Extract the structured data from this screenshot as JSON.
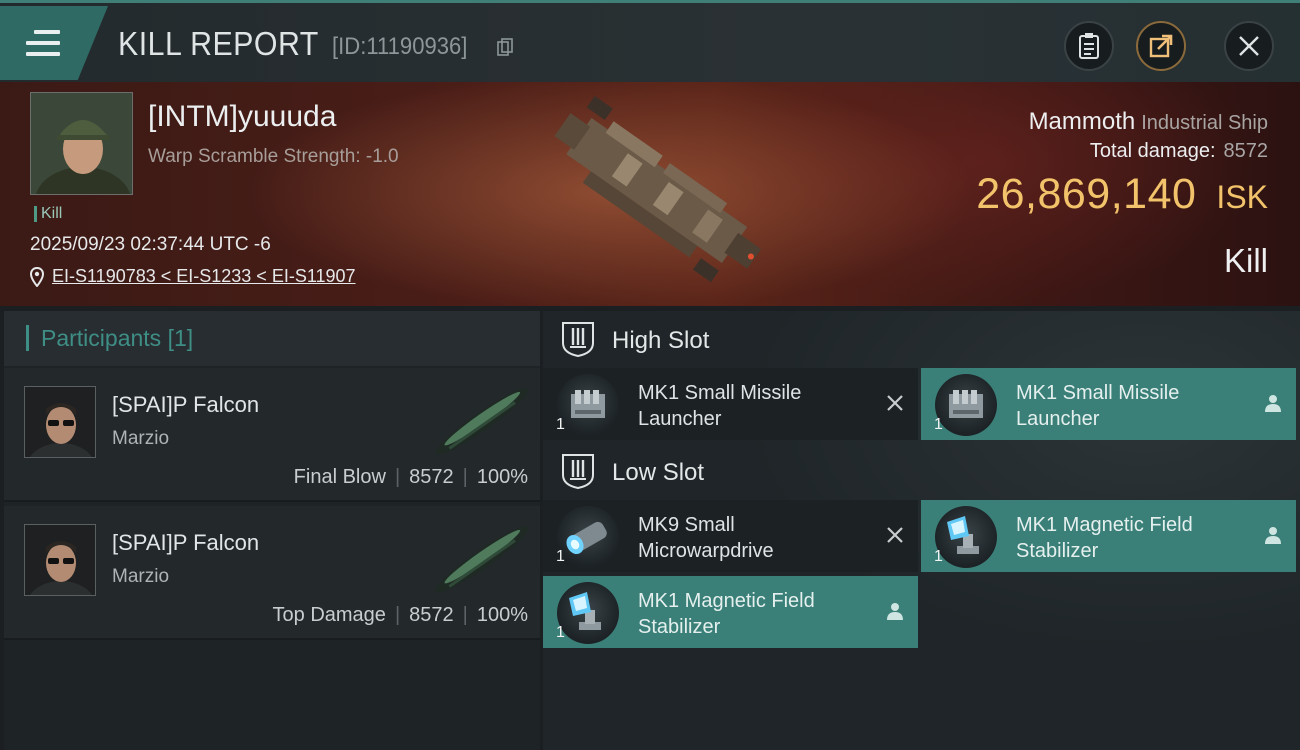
{
  "header": {
    "title": "KILL REPORT",
    "report_id": "[ID:11190936]",
    "icons": [
      "menu-icon",
      "copy-icon",
      "clipboard-icon",
      "share-icon",
      "close-icon"
    ]
  },
  "victim": {
    "name": "[INTM]yuuuda",
    "warp_scramble": "Warp Scramble Strength: -1.0",
    "tag": "Kill",
    "time": "2025/09/23 02:37:44 UTC -6",
    "location": "EI-S1190783 < EI-S1233 < EI-S11907",
    "ship_name": "Mammoth",
    "ship_class": "Industrial Ship",
    "total_damage_label": "Total damage:",
    "total_damage": "8572",
    "isk_value": "26,869,140",
    "isk_unit": "ISK",
    "result": "Kill"
  },
  "participants": {
    "label": "Participants",
    "count": "[1]",
    "rows": [
      {
        "name": "[SPAI]P Falcon",
        "ship": "Marzio",
        "role": "Final Blow",
        "damage": "8572",
        "percent": "100%"
      },
      {
        "name": "[SPAI]P Falcon",
        "ship": "Marzio",
        "role": "Top Damage",
        "damage": "8572",
        "percent": "100%"
      }
    ]
  },
  "fitting": {
    "high_slot": {
      "label": "High Slot",
      "modules": [
        {
          "name_line1": "MK1 Small Missile",
          "name_line2": "Launcher",
          "qty": "1",
          "state": "destroyed"
        },
        {
          "name_line1": "MK1 Small Missile",
          "name_line2": "Launcher",
          "qty": "1",
          "state": "dropped"
        }
      ]
    },
    "low_slot": {
      "label": "Low Slot",
      "modules": [
        {
          "name_line1": "MK9 Small",
          "name_line2": "Microwarpdrive",
          "qty": "1",
          "state": "destroyed"
        },
        {
          "name_line1": "MK1 Magnetic Field",
          "name_line2": "Stabilizer",
          "qty": "1",
          "state": "dropped"
        },
        {
          "name_line1": "MK1 Magnetic Field",
          "name_line2": "Stabilizer",
          "qty": "1",
          "state": "dropped"
        }
      ]
    }
  },
  "colors": {
    "accent": "#3f8e86",
    "dropped_bg": "#3a7f78",
    "isk": "#f2c36a",
    "banner": "#4a1d17"
  }
}
